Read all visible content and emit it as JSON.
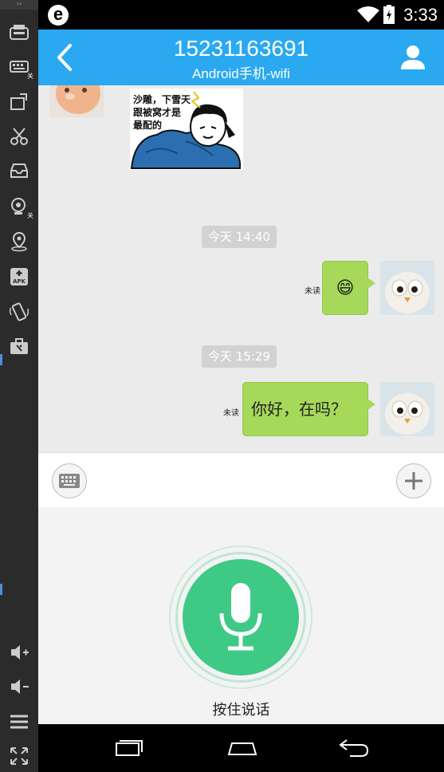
{
  "emulator": {
    "top_glyph": "››",
    "tools": [
      {
        "name": "keyboard-toggle",
        "icon": "controller-icon"
      },
      {
        "name": "keyboard-map",
        "icon": "keyboard-icon",
        "badge": "关"
      },
      {
        "name": "screen-rotate",
        "icon": "rotate-window-icon"
      },
      {
        "name": "screenshot",
        "icon": "scissors-icon"
      },
      {
        "name": "inbox",
        "icon": "tray-icon"
      },
      {
        "name": "camera",
        "icon": "webcam-icon",
        "badge": "关"
      },
      {
        "name": "location",
        "icon": "location-pin-icon"
      },
      {
        "name": "install-apk",
        "icon": "apk-icon",
        "label": "APK"
      },
      {
        "name": "shake",
        "icon": "shake-phone-icon"
      },
      {
        "name": "toolbox",
        "icon": "toolbox-icon"
      }
    ],
    "bottom_tools": [
      {
        "name": "volume-up",
        "icon": "volume-up-icon"
      },
      {
        "name": "volume-down",
        "icon": "volume-down-icon"
      },
      {
        "name": "menu",
        "icon": "menu-icon"
      },
      {
        "name": "fullscreen",
        "icon": "fullscreen-icon"
      }
    ]
  },
  "status_bar": {
    "logo": "e",
    "time": "3:33"
  },
  "header": {
    "title": "15231163691",
    "subtitle": "Android手机-wifi"
  },
  "chat": {
    "sticker_text": "沙雕，下雪天\n跟被窝才是\n最配的",
    "messages": [
      {
        "time": "今天  14:40",
        "status": "未读",
        "content": "😄"
      },
      {
        "time": "今天  15:29",
        "status": "未读",
        "content": "你好，在吗？"
      }
    ]
  },
  "voice": {
    "hold_label": "按住说话"
  },
  "colors": {
    "header": "#2aa9f0",
    "bubble": "#a6d85a",
    "mic": "#3ec985"
  }
}
